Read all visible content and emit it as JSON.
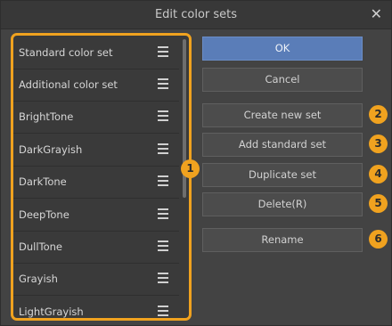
{
  "window": {
    "title": "Edit color sets"
  },
  "color_sets": [
    {
      "label": "Standard color set"
    },
    {
      "label": "Additional color set"
    },
    {
      "label": "BrightTone"
    },
    {
      "label": "DarkGrayish"
    },
    {
      "label": "DarkTone"
    },
    {
      "label": "DeepTone"
    },
    {
      "label": "DullTone"
    },
    {
      "label": "Grayish"
    },
    {
      "label": "LightGrayish"
    }
  ],
  "buttons": {
    "ok": "OK",
    "cancel": "Cancel",
    "create_new_set": "Create new set",
    "add_standard_set": "Add standard set",
    "duplicate_set": "Duplicate set",
    "delete": "Delete(R)",
    "rename": "Rename"
  },
  "callouts": {
    "one": "1",
    "two": "2",
    "three": "3",
    "four": "4",
    "five": "5",
    "six": "6"
  },
  "colors": {
    "highlight": "#f0a21f",
    "primary_button": "#5a7db8",
    "panel": "#434343"
  }
}
